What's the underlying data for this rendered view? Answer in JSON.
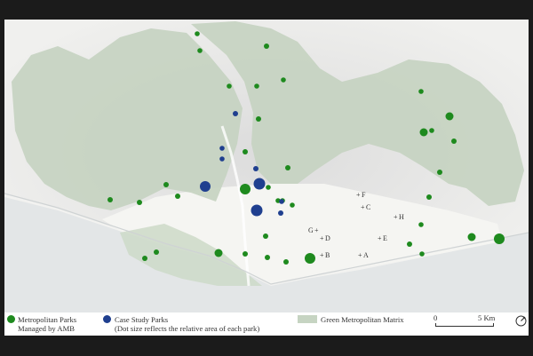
{
  "map": {
    "colors": {
      "metropolitan_park": "#1e8a1e",
      "case_study_park": "#1f3f8f",
      "green_matrix": "#c6d4c2",
      "sea": "#e2e5e6",
      "urban": "#f4f4f1"
    },
    "point_labels": [
      {
        "id": "F",
        "text": "F"
      },
      {
        "id": "C",
        "text": "C"
      },
      {
        "id": "H",
        "text": "H"
      },
      {
        "id": "G",
        "text": "G"
      },
      {
        "id": "D",
        "text": "D"
      },
      {
        "id": "E",
        "text": "E"
      },
      {
        "id": "B",
        "text": "B"
      },
      {
        "id": "A",
        "text": "A"
      }
    ],
    "metropolitan_parks_count": 48,
    "case_study_parks_count": 11
  },
  "legend": {
    "metropolitan_parks": "Metropolitan Parks",
    "managed_by": "Managed by AMB",
    "case_study_parks": "Case Study Parks",
    "dot_size_note": "(Dot size reflects the relative area of each park)",
    "green_matrix": "Green Metropolitan Matrix",
    "scale_start": "0",
    "scale_end": "5 Km",
    "north_icon": "north-arrow-icon"
  }
}
